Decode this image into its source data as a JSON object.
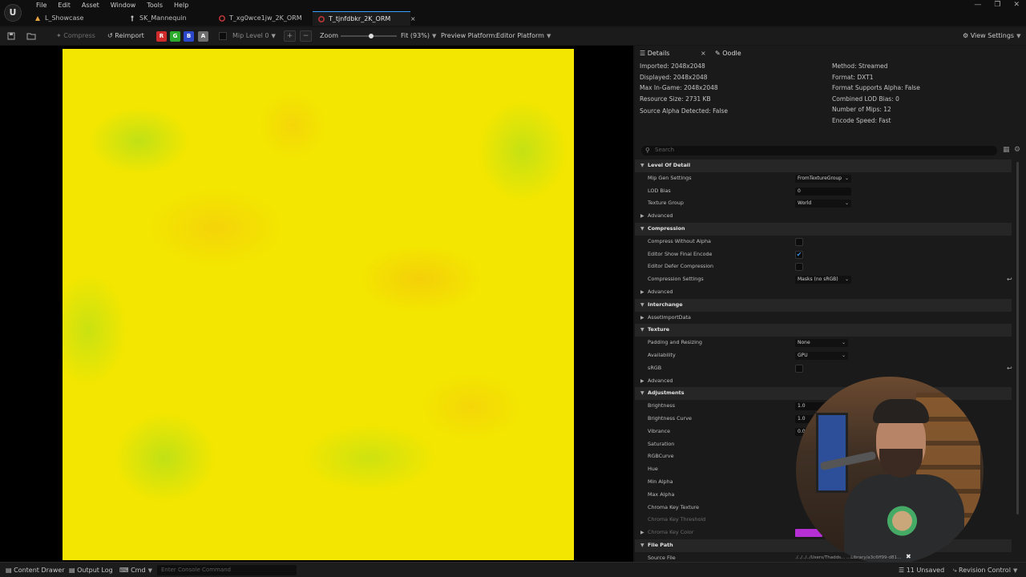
{
  "menu": [
    "File",
    "Edit",
    "Asset",
    "Window",
    "Tools",
    "Help"
  ],
  "tabs": [
    {
      "label": "L_Showcase",
      "icon": "level-icon",
      "active": false
    },
    {
      "label": "SK_Mannequin",
      "icon": "skeleton-icon",
      "active": false
    },
    {
      "label": "T_xg0wce1jw_2K_ORM",
      "icon": "texture-icon",
      "active": false
    },
    {
      "label": "T_tjnfdbkr_2K_ORM",
      "icon": "texture-icon",
      "active": true,
      "close": "×"
    }
  ],
  "toolbar": {
    "compress": "Compress",
    "reimport": "Reimport",
    "channels": [
      "R",
      "G",
      "B",
      "A"
    ],
    "mip": "Mip Level 0",
    "zoom_label": "Zoom",
    "zoom_value": "Fit (93%)",
    "preview_label": "Preview Platform:",
    "preview_value": "Editor Platform",
    "view_settings": "View Settings",
    "channel_colors": [
      "#d02b2b",
      "#2caa2c",
      "#2a48c9",
      "#6e6e6e"
    ]
  },
  "details": {
    "tab_details": "Details",
    "tab_close": "×",
    "tab_oodle": "Oodle",
    "info_left": [
      "Imported: 2048x2048",
      "Displayed: 2048x2048",
      "Max In-Game: 2048x2048",
      "Resource Size: 2731 KB",
      "Source Alpha Detected: False"
    ],
    "info_right": [
      "Method: Streamed",
      "Format: DXT1",
      "Format Supports Alpha: False",
      "Combined LOD Bias: 0",
      "Number of Mips: 12",
      "Encode Speed: Fast"
    ],
    "search_placeholder": "Search",
    "rows": [
      {
        "kind": "cat",
        "name": "Level Of Detail"
      },
      {
        "kind": "prop",
        "name": "Mip Gen Settings",
        "type": "combo",
        "value": "FromTextureGroup"
      },
      {
        "kind": "prop",
        "name": "LOD Bias",
        "type": "num",
        "value": "0"
      },
      {
        "kind": "prop",
        "name": "Texture Group",
        "type": "combo",
        "value": "World"
      },
      {
        "kind": "sub",
        "name": "Advanced"
      },
      {
        "kind": "cat",
        "name": "Compression"
      },
      {
        "kind": "prop",
        "name": "Compress Without Alpha",
        "type": "check",
        "value": false
      },
      {
        "kind": "prop",
        "name": "Editor Show Final Encode",
        "type": "check",
        "value": true
      },
      {
        "kind": "prop",
        "name": "Editor Defer Compression",
        "type": "check",
        "value": false
      },
      {
        "kind": "prop",
        "name": "Compression Settings",
        "type": "combo",
        "value": "Masks (no sRGB)",
        "reset": true
      },
      {
        "kind": "sub",
        "name": "Advanced"
      },
      {
        "kind": "cat",
        "name": "Interchange"
      },
      {
        "kind": "sub",
        "name": "AssetImportData"
      },
      {
        "kind": "cat",
        "name": "Texture"
      },
      {
        "kind": "prop",
        "name": "Padding and Resizing",
        "type": "combo",
        "value": "None"
      },
      {
        "kind": "prop",
        "name": "Availability",
        "type": "combo",
        "value": "GPU"
      },
      {
        "kind": "prop",
        "name": "sRGB",
        "type": "check",
        "value": false,
        "reset": true
      },
      {
        "kind": "sub",
        "name": "Advanced"
      },
      {
        "kind": "cat",
        "name": "Adjustments"
      },
      {
        "kind": "prop",
        "name": "Brightness",
        "type": "num",
        "value": "1.0"
      },
      {
        "kind": "prop",
        "name": "Brightness Curve",
        "type": "num",
        "value": "1.0"
      },
      {
        "kind": "prop",
        "name": "Vibrance",
        "type": "num",
        "value": "0.0"
      },
      {
        "kind": "prop",
        "name": "Saturation",
        "type": "none",
        "value": ""
      },
      {
        "kind": "prop",
        "name": "RGBCurve",
        "type": "none",
        "value": ""
      },
      {
        "kind": "prop",
        "name": "Hue",
        "type": "none",
        "value": ""
      },
      {
        "kind": "prop",
        "name": "Min Alpha",
        "type": "none",
        "value": ""
      },
      {
        "kind": "prop",
        "name": "Max Alpha",
        "type": "none",
        "value": ""
      },
      {
        "kind": "prop",
        "name": "Chroma Key Texture",
        "type": "none",
        "value": ""
      },
      {
        "kind": "dim",
        "name": "Chroma Key Threshold",
        "type": "none",
        "value": ""
      },
      {
        "kind": "dimsub",
        "name": "Chroma Key Color",
        "type": "color",
        "value": ""
      },
      {
        "kind": "cat",
        "name": "File Path"
      },
      {
        "kind": "prop",
        "name": "Source File",
        "type": "none",
        "value": ""
      }
    ],
    "source_file_value": "./../../../Users/Thadds...",
    "source_file_tail": "...Library/a3c6ff99-d81...",
    "chroma_color": "#b62fd4"
  },
  "statusbar": {
    "content_drawer": "Content Drawer",
    "output_log": "Output Log",
    "cmd": "Cmd",
    "console_placeholder": "Enter Console Command",
    "unsaved": "11 Unsaved",
    "revision": "Revision Control"
  }
}
